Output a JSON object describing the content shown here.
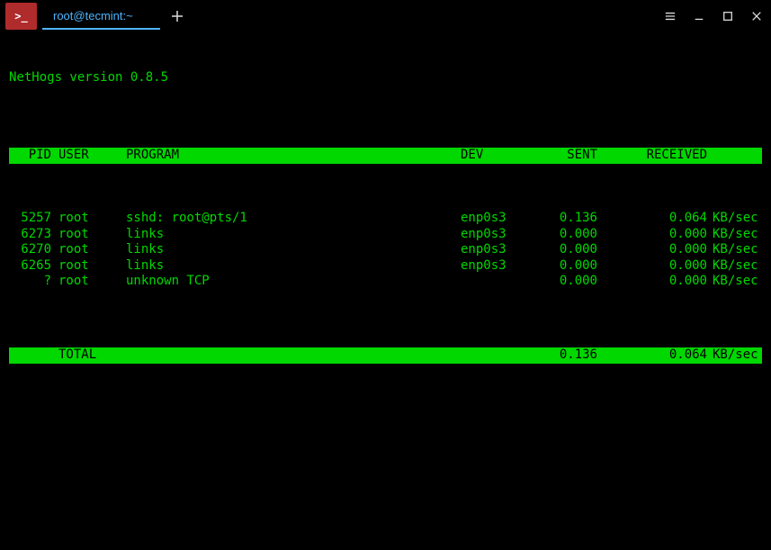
{
  "window": {
    "tab_title": "root@tecmint:~"
  },
  "version": "NetHogs version 0.8.5",
  "headers": {
    "pid": "PID",
    "user": "USER",
    "program": "PROGRAM",
    "dev": "DEV",
    "sent": "SENT",
    "received": "RECEIVED"
  },
  "rows": [
    {
      "pid": "5257",
      "user": "root",
      "program": "sshd: root@pts/1",
      "dev": "enp0s3",
      "sent": "0.136",
      "received": "0.064",
      "unit": "KB/sec"
    },
    {
      "pid": "6273",
      "user": "root",
      "program": "links",
      "dev": "enp0s3",
      "sent": "0.000",
      "received": "0.000",
      "unit": "KB/sec"
    },
    {
      "pid": "6270",
      "user": "root",
      "program": "links",
      "dev": "enp0s3",
      "sent": "0.000",
      "received": "0.000",
      "unit": "KB/sec"
    },
    {
      "pid": "6265",
      "user": "root",
      "program": "links",
      "dev": "enp0s3",
      "sent": "0.000",
      "received": "0.000",
      "unit": "KB/sec"
    },
    {
      "pid": "?",
      "user": "root",
      "program": "unknown TCP",
      "dev": "",
      "sent": "0.000",
      "received": "0.000",
      "unit": "KB/sec"
    }
  ],
  "total": {
    "label": "TOTAL",
    "sent": "0.136",
    "received": "0.064",
    "unit": "KB/sec"
  }
}
